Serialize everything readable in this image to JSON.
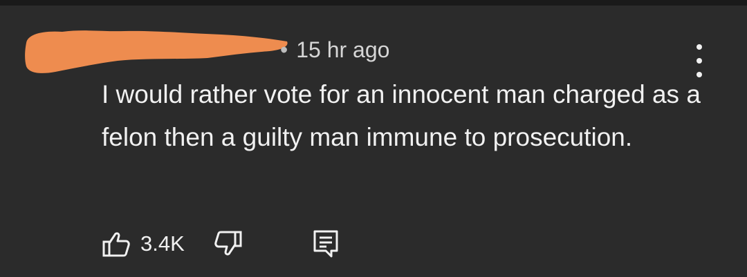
{
  "comment": {
    "author_redacted": true,
    "timestamp": "15 hr ago",
    "separator": "•",
    "text": "I would rather vote for an innocent man charged as a felon then a guilty man immune to prosecution.",
    "like_count": "3.4K"
  },
  "icons": {
    "more": "more-vert-icon",
    "like": "thumbs-up-icon",
    "dislike": "thumbs-down-icon",
    "reply": "reply-icon"
  },
  "colors": {
    "background": "#2b2b2b",
    "redaction": "#ee8c4f",
    "text": "#f1f1f1",
    "meta": "#d6d6d6"
  }
}
